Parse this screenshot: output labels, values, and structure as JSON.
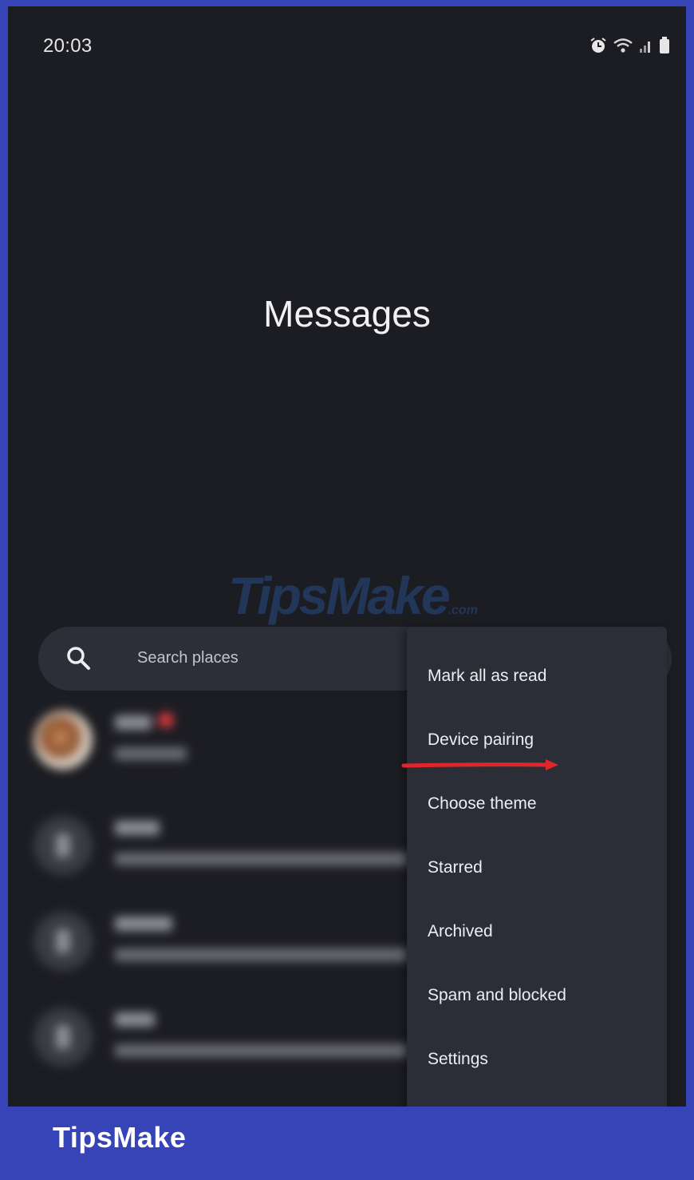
{
  "status_bar": {
    "time": "20:03",
    "icons": [
      "alarm-icon",
      "wifi-icon",
      "signal-icon",
      "battery-icon"
    ]
  },
  "app": {
    "title": "Messages"
  },
  "watermark": {
    "text": "TipsMake",
    "domain": ".com"
  },
  "search": {
    "placeholder": "Search places"
  },
  "conversations": [
    {
      "avatar": "photo",
      "unread": true
    },
    {
      "avatar": "placeholder",
      "unread": false
    },
    {
      "avatar": "placeholder",
      "unread": false
    },
    {
      "avatar": "placeholder",
      "unread": false
    }
  ],
  "menu": {
    "items": [
      "Mark all as read",
      "Device pairing",
      "Choose theme",
      "Starred",
      "Archived",
      "Spam and blocked",
      "Settings"
    ],
    "highlighted_item": "Device pairing"
  },
  "annotation": {
    "arrow_color": "#e0262b"
  },
  "footer": {
    "label": "TipsMake"
  },
  "colors": {
    "border_blue": "#3644b8",
    "app_background": "#1c1d22",
    "surface": "#2c2f38",
    "menu_background": "#2b2e37"
  }
}
